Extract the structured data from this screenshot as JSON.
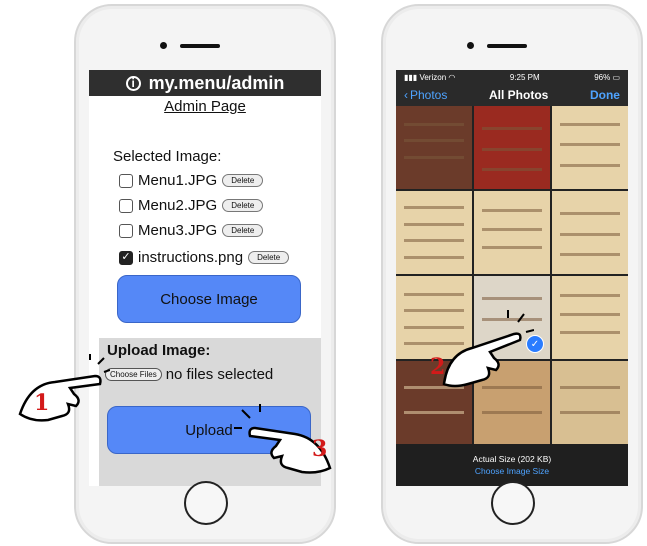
{
  "left_phone": {
    "url": "my.menu/admin",
    "admin_title": "Admin Page",
    "selected_label": "Selected Image:",
    "files": [
      {
        "name": "Menu1.JPG",
        "checked": false,
        "delete_label": "Delete"
      },
      {
        "name": "Menu2.JPG",
        "checked": false,
        "delete_label": "Delete"
      },
      {
        "name": "Menu3.JPG",
        "checked": false,
        "delete_label": "Delete"
      },
      {
        "name": "instructions.png",
        "checked": true,
        "delete_label": "Delete"
      }
    ],
    "choose_image_label": "Choose Image",
    "upload_label": "Upload Image:",
    "choose_files_label": "Choose Files",
    "no_files_text": "no files selected",
    "upload_button_label": "Upload"
  },
  "right_phone": {
    "status": {
      "carrier": "Verizon",
      "time": "9:25 PM",
      "battery": "96%"
    },
    "nav": {
      "back_label": "Photos",
      "title": "All Photos",
      "done_label": "Done"
    },
    "footer": {
      "size_text": "Actual Size (202 KB)",
      "choose_size_label": "Choose Image Size"
    }
  },
  "steps": [
    "1",
    "2",
    "3"
  ],
  "colors": {
    "button_blue": "#5588f7",
    "link_blue": "#4ea3ff",
    "step_red": "#d31a1a"
  }
}
